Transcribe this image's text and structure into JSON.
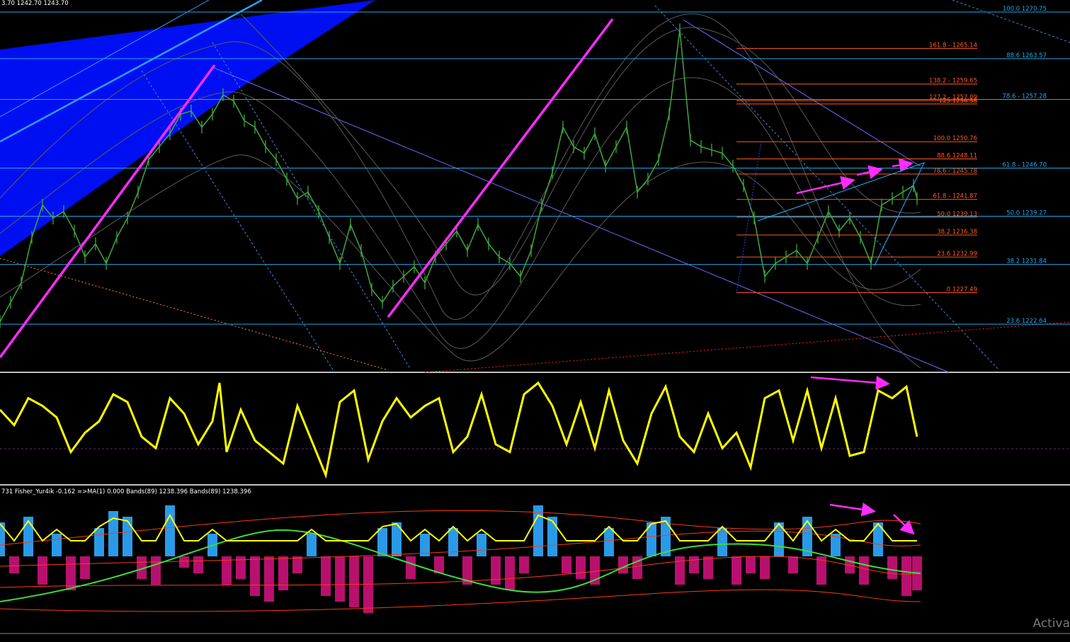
{
  "header": {
    "ohlc_text": "3.70 1242.70 1243.70"
  },
  "fib_left": [
    {
      "label": "161.8 - 1265.14",
      "y": 1265.14
    },
    {
      "label": "138.2 - 1259.65",
      "y": 1259.65
    },
    {
      "label": "127.2 - 1257.09",
      "y": 1257.09
    },
    {
      "label": "125 1256.58",
      "y": 1256.58
    },
    {
      "label": "100.0 1250.76",
      "y": 1250.76
    },
    {
      "label": "88.6 1248.11",
      "y": 1248.11
    },
    {
      "label": "78.6 - 1245.78",
      "y": 1245.78
    },
    {
      "label": "61.8 - 1241.87",
      "y": 1241.87
    },
    {
      "label": "50.0 1239.13",
      "y": 1239.13
    },
    {
      "label": "38.2 1236.38",
      "y": 1236.38
    },
    {
      "label": "23.6 1232.99",
      "y": 1232.99
    },
    {
      "label": "0 1227.49",
      "y": 1227.49
    }
  ],
  "fib_right": [
    {
      "label": "100.0 1270.75",
      "y": 1270.75
    },
    {
      "label": "88.6 1263.57",
      "y": 1263.57
    },
    {
      "label": "78.6 - 1257.28",
      "y": 1257.28
    },
    {
      "label": "61.8 - 1246.70",
      "y": 1246.7
    },
    {
      "label": "50.0 1239.27",
      "y": 1239.27
    },
    {
      "label": "38.2 1231.84",
      "y": 1231.84
    },
    {
      "label": "23.6 1222.64",
      "y": 1222.64
    }
  ],
  "indicator_caption": "731  Fisher_Yur4ik -0.162  =>MA(1) 0.000  Bands(89) 1238.396  Bands(89) 1238.396",
  "watermark": "Activa",
  "colors": {
    "price": "#3fa83f",
    "fib_left": "#ff5a1e",
    "fib_right": "#20a8e8",
    "oscillator": "#ffff00",
    "pos_hist": "#2a9ae8",
    "neg_hist": "#b8106e",
    "signal": "#3ddc3d",
    "bands": "#ff3a10",
    "annot": "#ff2cff",
    "channel": "#0010ff"
  },
  "chart_data": [
    {
      "type": "line",
      "panel": "price",
      "ylim": [
        1216.5,
        1272.0
      ],
      "x": [
        0,
        15,
        30,
        45,
        60,
        75,
        90,
        105,
        120,
        135,
        150,
        165,
        180,
        195,
        210,
        225,
        240,
        255,
        270,
        285,
        300,
        315,
        330,
        345,
        360,
        375,
        390,
        405,
        420,
        435,
        450,
        465,
        480,
        495,
        510,
        525,
        540,
        555,
        570,
        585,
        600,
        615,
        630,
        645,
        660,
        675,
        690,
        705,
        720,
        735,
        750,
        765,
        780,
        795,
        810,
        825,
        840,
        855,
        870,
        885,
        900,
        915,
        930,
        945,
        960,
        975,
        990,
        1005,
        1020,
        1035,
        1050,
        1065,
        1080,
        1095,
        1110,
        1125,
        1140,
        1155,
        1170,
        1185,
        1200,
        1215,
        1230,
        1245,
        1260,
        1275,
        1290,
        1295
      ],
      "values": [
        1223.0,
        1226.0,
        1229.0,
        1236.0,
        1241.0,
        1239.0,
        1240.0,
        1237.0,
        1233.0,
        1235.0,
        1232.0,
        1236.0,
        1239.0,
        1243.0,
        1248.0,
        1250.0,
        1252.0,
        1255.0,
        1255.5,
        1253.0,
        1255.0,
        1258.0,
        1257.0,
        1254.0,
        1253.0,
        1250.0,
        1248.0,
        1245.0,
        1242.0,
        1243.0,
        1240.0,
        1236.0,
        1232.0,
        1238.0,
        1234.0,
        1228.0,
        1226.0,
        1228.5,
        1230.0,
        1231.5,
        1229.0,
        1233.0,
        1235.0,
        1237.0,
        1234.0,
        1238.0,
        1235.0,
        1233.0,
        1232.0,
        1230.0,
        1234.0,
        1241.0,
        1246.0,
        1253.0,
        1250.0,
        1249.0,
        1252.0,
        1247.0,
        1250.0,
        1253.0,
        1243.0,
        1245.0,
        1248.0,
        1255.0,
        1268.0,
        1251.0,
        1250.0,
        1249.5,
        1249.0,
        1247.0,
        1244.0,
        1239.0,
        1230.0,
        1232.0,
        1233.0,
        1234.0,
        1232.0,
        1236.0,
        1240.0,
        1237.0,
        1239.0,
        1236.0,
        1232.0,
        1241.0,
        1242.0,
        1243.0,
        1244.0,
        1242.0
      ]
    },
    {
      "type": "line",
      "panel": "oscillator",
      "ylim": [
        -1.4,
        1.4
      ],
      "x": [
        0,
        20,
        40,
        60,
        80,
        100,
        120,
        140,
        160,
        180,
        200,
        220,
        240,
        260,
        280,
        300,
        310,
        320,
        340,
        360,
        380,
        400,
        420,
        440,
        460,
        480,
        500,
        520,
        540,
        560,
        580,
        600,
        620,
        640,
        660,
        680,
        700,
        720,
        740,
        760,
        780,
        800,
        820,
        840,
        860,
        880,
        900,
        920,
        940,
        960,
        980,
        1000,
        1020,
        1040,
        1060,
        1080,
        1100,
        1120,
        1140,
        1160,
        1180,
        1200,
        1220,
        1240,
        1260,
        1280,
        1295
      ],
      "values": [
        0.5,
        0.1,
        0.8,
        0.6,
        0.3,
        -0.6,
        -0.1,
        0.2,
        0.9,
        0.7,
        -0.2,
        -0.5,
        0.8,
        0.4,
        -0.4,
        0.2,
        1.2,
        -0.6,
        0.5,
        -0.3,
        -0.6,
        -0.9,
        0.6,
        -0.3,
        -1.2,
        0.7,
        1.0,
        -0.8,
        0.2,
        0.8,
        0.3,
        0.6,
        0.8,
        -0.6,
        -0.2,
        0.9,
        -0.4,
        -0.6,
        0.9,
        1.2,
        0.6,
        -0.4,
        0.7,
        -0.5,
        1.0,
        -0.3,
        -0.9,
        0.4,
        1.1,
        -0.2,
        -0.6,
        0.4,
        -0.5,
        -0.1,
        -1.0,
        0.8,
        1.0,
        -0.3,
        1.0,
        -0.5,
        0.8,
        -0.7,
        -0.6,
        1.0,
        0.8,
        1.1,
        -0.2
      ]
    },
    {
      "type": "bar",
      "panel": "fisher",
      "ylim": [
        -1.3,
        1.3
      ],
      "x": [
        0,
        20,
        40,
        60,
        80,
        100,
        120,
        140,
        160,
        180,
        200,
        220,
        240,
        260,
        280,
        300,
        320,
        340,
        360,
        380,
        400,
        420,
        440,
        460,
        480,
        500,
        520,
        540,
        560,
        580,
        600,
        620,
        640,
        660,
        680,
        700,
        720,
        740,
        760,
        780,
        800,
        820,
        840,
        860,
        880,
        900,
        920,
        940,
        960,
        980,
        1000,
        1020,
        1040,
        1060,
        1080,
        1100,
        1120,
        1140,
        1160,
        1180,
        1200,
        1220,
        1240,
        1260,
        1280,
        1295
      ],
      "values": [
        0.6,
        -0.3,
        0.7,
        -0.5,
        0.4,
        -0.6,
        -0.4,
        0.5,
        0.8,
        0.7,
        -0.4,
        -0.5,
        0.9,
        -0.2,
        -0.3,
        0.4,
        -0.5,
        -0.4,
        -0.7,
        -0.8,
        -0.6,
        -0.3,
        0.4,
        -0.7,
        -0.8,
        -0.9,
        -1.0,
        0.5,
        0.6,
        -0.4,
        0.4,
        -0.3,
        0.5,
        -0.5,
        0.4,
        -0.5,
        -0.6,
        -0.3,
        0.9,
        0.7,
        -0.3,
        -0.4,
        -0.5,
        0.5,
        -0.3,
        -0.4,
        0.6,
        0.7,
        -0.5,
        -0.3,
        -0.4,
        0.5,
        -0.5,
        -0.3,
        -0.4,
        0.6,
        -0.3,
        0.7,
        -0.5,
        0.4,
        -0.3,
        -0.5,
        0.6,
        -0.4,
        -0.7,
        -0.6
      ]
    }
  ]
}
